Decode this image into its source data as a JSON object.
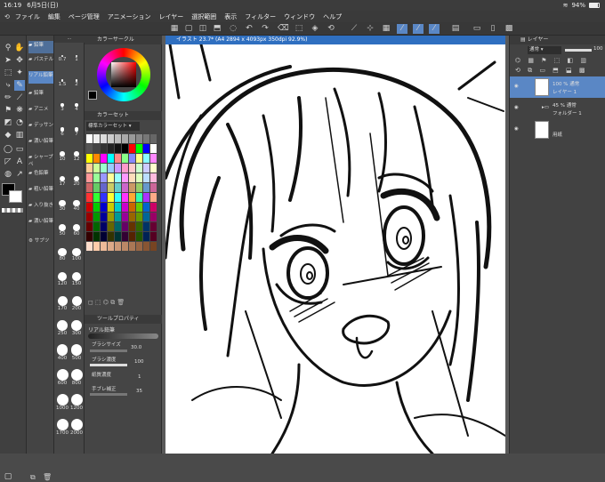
{
  "status": {
    "time": "16:19",
    "date": "6月5日(日)",
    "battery": "94%"
  },
  "menu": [
    "ファイル",
    "編集",
    "ページ管理",
    "アニメーション",
    "レイヤー",
    "選択範囲",
    "表示",
    "フィルター",
    "ウィンドウ",
    "ヘルプ"
  ],
  "subtool": {
    "items": [
      "鉛筆",
      "パステル",
      "リアル鉛筆",
      "鉛筆",
      "アニメ",
      "デッサン",
      "濃い鉛筆",
      "シャープペ",
      "色鉛筆",
      "粗い鉛筆",
      "入り抜き",
      "濃い鉛筆",
      "サブツ"
    ]
  },
  "brush_sizes": {
    "left": [
      "0.7",
      "1.5",
      "3",
      "6",
      "10",
      "17",
      "30",
      "50",
      "80",
      "120",
      "170",
      "250",
      "400",
      "600",
      "1000",
      "1700"
    ],
    "right": [
      "1",
      "2",
      "4",
      "7",
      "12",
      "20",
      "40",
      "60",
      "100",
      "150",
      "200",
      "300",
      "500",
      "800",
      "1200",
      "2000"
    ]
  },
  "color_panel": {
    "title": "カラーサークル",
    "set_title": "カラーセット",
    "set_name": "標準カラーセット"
  },
  "tool_property": {
    "title": "ツールプロパティ",
    "name": "リアル鉛筆",
    "brush_size_label": "ブラシサイズ",
    "brush_size_value": "30.0",
    "density_label": "ブラシ濃度",
    "density_value": "100",
    "hand_correction_label": "手ブレ補正",
    "hand_correction_value": "35",
    "texture_label": "紙質濃度",
    "texture_value": "1"
  },
  "canvas": {
    "tab": "イラスト 23.7* (A4 2894 x 4093px 350dpi 92.9%)"
  },
  "layers": {
    "title": "レイヤー",
    "blend": "通常",
    "opacity_value": "100",
    "items": [
      {
        "line1": "100 % 通常",
        "line2": "レイヤー 1"
      },
      {
        "line1": "45 % 通常",
        "line2": "フォルダー 1"
      },
      {
        "line1": "",
        "line2": "用紙"
      }
    ]
  },
  "colors": {
    "accent": "#2f6fc0"
  }
}
